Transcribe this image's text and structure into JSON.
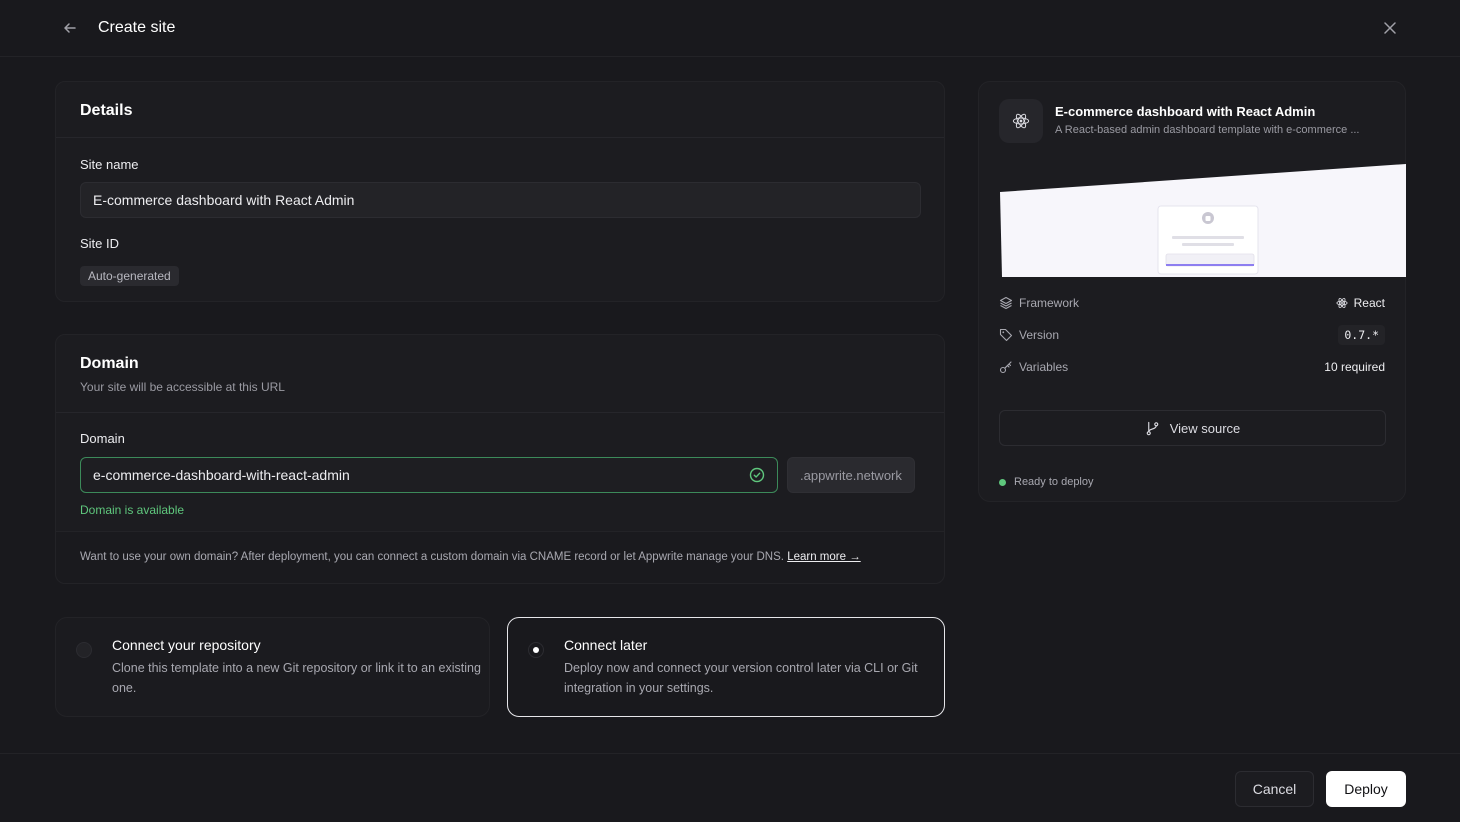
{
  "header": {
    "title": "Create site"
  },
  "details": {
    "title": "Details",
    "site_name_label": "Site name",
    "site_name_value": "E-commerce dashboard with React Admin",
    "site_id_label": "Site ID",
    "site_id_value": "Auto-generated"
  },
  "domain": {
    "title": "Domain",
    "subtitle": "Your site will be accessible at this URL",
    "field_label": "Domain",
    "value": "e-commerce-dashboard-with-react-admin",
    "suffix": ".appwrite.network",
    "status": "Domain is available",
    "note": "Want to use your own domain? After deployment, you can connect a custom domain via CNAME record or let Appwrite manage your DNS.",
    "learn_more": "Learn more →"
  },
  "options": [
    {
      "title": "Connect your repository",
      "desc": "Clone this template into a new Git repository or link it to an existing one.",
      "selected": false
    },
    {
      "title": "Connect later",
      "desc": "Deploy now and connect your version control later via CLI or Git integration in your settings.",
      "selected": true
    }
  ],
  "template": {
    "title": "E-commerce dashboard with React Admin",
    "desc": "A React-based admin dashboard template with e-commerce ...",
    "framework_label": "Framework",
    "framework_value": "React",
    "version_label": "Version",
    "version_value": "0.7.*",
    "variables_label": "Variables",
    "variables_value": "10 required",
    "view_source": "View source",
    "status": "Ready to deploy"
  },
  "footer": {
    "cancel": "Cancel",
    "deploy": "Deploy"
  },
  "colors": {
    "background": "#19191d",
    "accent_ok": "#5fc77d",
    "primary_button": "#ffffff"
  }
}
